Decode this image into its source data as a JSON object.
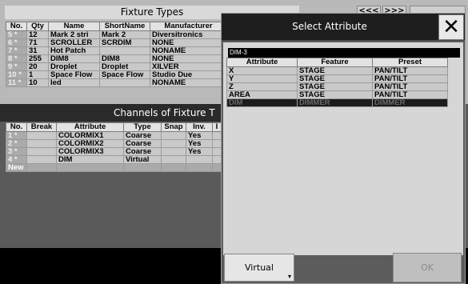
{
  "fixture_types": {
    "title": "Fixture Types",
    "nav_prev": "<<<",
    "nav_next": ">>>",
    "columns": [
      "No.",
      "Qty",
      "Name",
      "ShortName",
      "Manufacturer"
    ],
    "rows": [
      {
        "no": "5 *",
        "qty": "12",
        "name": "Mark 2 stri",
        "short": "Mark 2",
        "mfr": "Diversitronics"
      },
      {
        "no": "6 *",
        "qty": "71",
        "name": "SCROLLER",
        "short": "SCRDIM",
        "mfr": "NONE"
      },
      {
        "no": "7 *",
        "qty": "31",
        "name": "Hot Patch",
        "short": "",
        "mfr": "NONAME"
      },
      {
        "no": "8 *",
        "qty": "255",
        "name": "DIM8",
        "short": "DIM8",
        "mfr": "NONE"
      },
      {
        "no": "9 *",
        "qty": "20",
        "name": "Droplet",
        "short": "Droplet",
        "mfr": "XILVER"
      },
      {
        "no": "10 *",
        "qty": "1",
        "name": "Space Flow",
        "short": "Space Flow",
        "mfr": "Studio Due"
      },
      {
        "no": "11 *",
        "qty": "10",
        "name": "led",
        "short": "",
        "mfr": "NONAME"
      }
    ]
  },
  "channels": {
    "title": "Channels of Fixture T",
    "columns": [
      "No.",
      "Break",
      "Attribute",
      "Type",
      "Snap",
      "Inv.",
      "I"
    ],
    "rows": [
      {
        "no": "1 *",
        "brk": "",
        "attr": "COLORMIX1",
        "type": "Coarse",
        "snap": "",
        "inv": "Yes"
      },
      {
        "no": "2 *",
        "brk": "",
        "attr": "COLORMIX2",
        "type": "Coarse",
        "snap": "",
        "inv": "Yes"
      },
      {
        "no": "3 *",
        "brk": "",
        "attr": "COLORMIX3",
        "type": "Coarse",
        "snap": "",
        "inv": "Yes"
      },
      {
        "no": "4 *",
        "brk": "",
        "attr": "DIM",
        "type": "Virtual",
        "snap": "",
        "inv": ""
      }
    ],
    "new_label": "New"
  },
  "dialog": {
    "title": "Select Attribute",
    "close_glyph": "✕",
    "filter_value": "DIM-3",
    "columns": [
      "Attribute",
      "Feature",
      "Preset"
    ],
    "rows": [
      {
        "attr": "X",
        "feature": "STAGE",
        "preset": "PAN/TILT"
      },
      {
        "attr": "Y",
        "feature": "STAGE",
        "preset": "PAN/TILT"
      },
      {
        "attr": "Z",
        "feature": "STAGE",
        "preset": "PAN/TILT"
      },
      {
        "attr": "AREA",
        "feature": "STAGE",
        "preset": "PAN/TILT"
      },
      {
        "attr": "DIM",
        "feature": "DIMMER",
        "preset": "DIMMER"
      }
    ],
    "virtual_label": "Virtual",
    "ok_label": "OK"
  }
}
